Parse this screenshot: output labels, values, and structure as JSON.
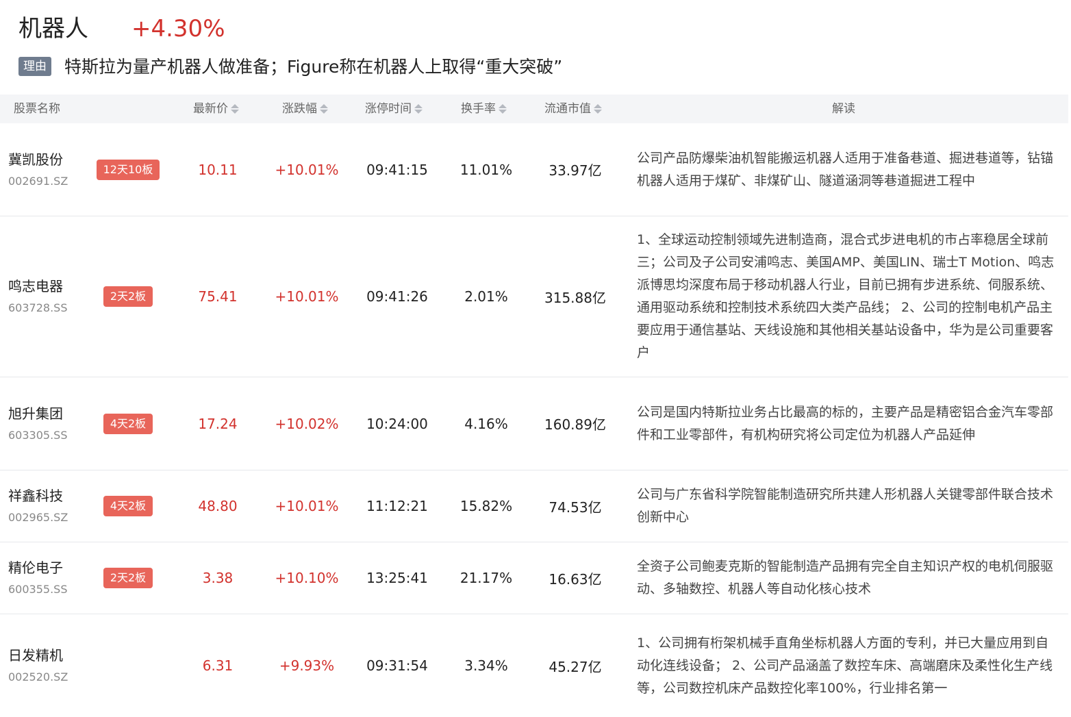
{
  "header": {
    "title": "机器人",
    "change": "+4.30%",
    "reason_label": "理由",
    "reason_text": "特斯拉为量产机器人做准备；Figure称在机器人上取得“重大突破”"
  },
  "columns": {
    "name": "股票名称",
    "price": "最新价",
    "pct": "涨跌幅",
    "limit_time": "涨停时间",
    "turnover": "换手率",
    "market_cap": "流通市值",
    "analysis": "解读"
  },
  "rows": [
    {
      "name": "冀凯股份",
      "code": "002691.SZ",
      "badge": "12天10板",
      "price": "10.11",
      "pct": "+10.01%",
      "time": "09:41:15",
      "turnover": "11.01%",
      "cap": "33.97亿",
      "desc": "公司产品防爆柴油机智能搬运机器人适用于准备巷道、掘进巷道等，钻锚机器人适用于煤矿、非煤矿山、隧道涵洞等巷道掘进工程中"
    },
    {
      "name": "鸣志电器",
      "code": "603728.SS",
      "badge": "2天2板",
      "price": "75.41",
      "pct": "+10.01%",
      "time": "09:41:26",
      "turnover": "2.01%",
      "cap": "315.88亿",
      "desc": "1、全球运动控制领域先进制造商，混合式步进电机的市占率稳居全球前三；公司及子公司安浦鸣志、美国AMP、美国LIN、瑞士T Motion、鸣志派博思均深度布局于移动机器人行业，目前已拥有步进系统、伺服系统、通用驱动系统和控制技术系统四大类产品线； 2、公司的控制电机产品主要应用于通信基站、天线设施和其他相关基站设备中，华为是公司重要客户"
    },
    {
      "name": "旭升集团",
      "code": "603305.SS",
      "badge": "4天2板",
      "price": "17.24",
      "pct": "+10.02%",
      "time": "10:24:00",
      "turnover": "4.16%",
      "cap": "160.89亿",
      "desc": "公司是国内特斯拉业务占比最高的标的，主要产品是精密铝合金汽车零部件和工业零部件，有机构研究将公司定位为机器人产品延伸"
    },
    {
      "name": "祥鑫科技",
      "code": "002965.SZ",
      "badge": "4天2板",
      "price": "48.80",
      "pct": "+10.01%",
      "time": "11:12:21",
      "turnover": "15.82%",
      "cap": "74.53亿",
      "desc": "公司与广东省科学院智能制造研究所共建人形机器人关键零部件联合技术创新中心"
    },
    {
      "name": "精伦电子",
      "code": "600355.SS",
      "badge": "2天2板",
      "price": "3.38",
      "pct": "+10.10%",
      "time": "13:25:41",
      "turnover": "21.17%",
      "cap": "16.63亿",
      "desc": "全资子公司鲍麦克斯的智能制造产品拥有完全自主知识产权的电机伺服驱动、多轴数控、机器人等自动化核心技术"
    },
    {
      "name": "日发精机",
      "code": "002520.SZ",
      "badge": "",
      "price": "6.31",
      "pct": "+9.93%",
      "time": "09:31:54",
      "turnover": "3.34%",
      "cap": "45.27亿",
      "desc": "1、公司拥有桁架机械手直角坐标机器人方面的专利，并已大量应用到自动化连线设备； 2、公司产品涵盖了数控车床、高端磨床及柔性化生产线等，公司数控机床产品数控化率100%，行业排名第一"
    }
  ]
}
